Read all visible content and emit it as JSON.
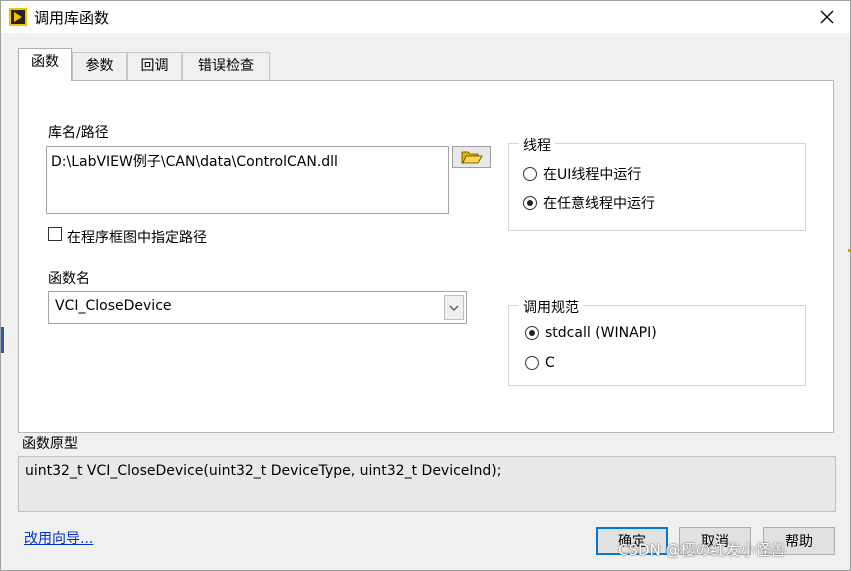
{
  "title": "调用库函数",
  "tabs": [
    "函数",
    "参数",
    "回调",
    "错误检查"
  ],
  "library": {
    "label": "库名/路径",
    "path": "D:\\LabVIEW例子\\CAN\\data\\ControlCAN.dll",
    "browse_icon": "folder-open-icon",
    "specify_path_label": "在程序框图中指定路径",
    "specify_path_checked": false
  },
  "function": {
    "label": "函数名",
    "value": "VCI_CloseDevice"
  },
  "thread": {
    "title": "线程",
    "options": [
      "在UI线程中运行",
      "在任意线程中运行"
    ],
    "selected": 1
  },
  "calling_convention": {
    "title": "调用规范",
    "options": [
      "stdcall (WINAPI)",
      "C"
    ],
    "selected": 0
  },
  "prototype": {
    "label": "函数原型",
    "text": "uint32_t VCI_CloseDevice(uint32_t DeviceType, uint32_t DeviceInd);"
  },
  "wizard_link": "改用向导...",
  "buttons": {
    "ok": "确定",
    "cancel": "取消",
    "help": "帮助"
  },
  "watermark": "CSDN @樱の红发小怪兽",
  "colors": {
    "accent": "#0078d7",
    "link": "#0033cc"
  }
}
